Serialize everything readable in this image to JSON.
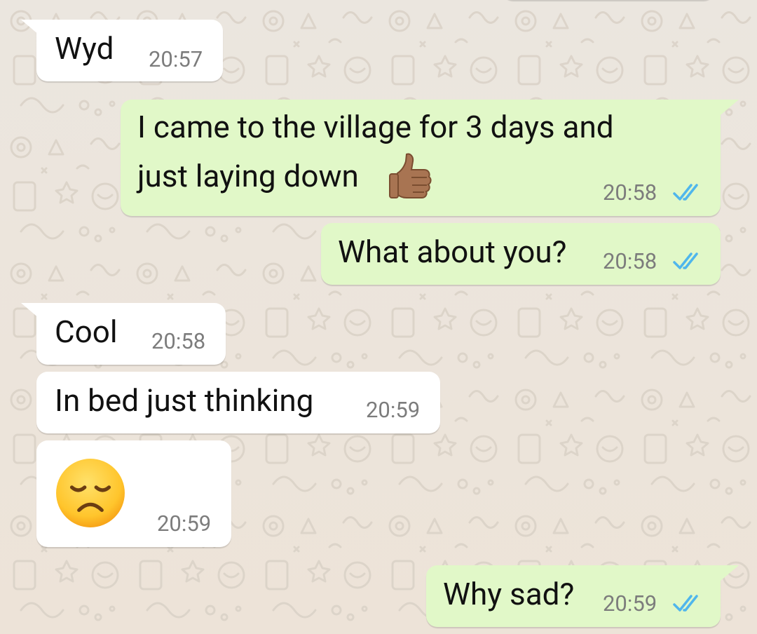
{
  "chat": {
    "messages": [
      {
        "direction": "incoming",
        "text": "Wyd",
        "time": "20:57"
      },
      {
        "direction": "outgoing",
        "text_line1": "I came to the village for 3 days and",
        "text_line2": "just laying down",
        "emoji": "thumbs-up-icon",
        "time": "20:58",
        "status": "read"
      },
      {
        "direction": "outgoing",
        "text": "What about you?",
        "time": "20:58",
        "status": "read"
      },
      {
        "direction": "incoming",
        "text": "Cool",
        "time": "20:58"
      },
      {
        "direction": "incoming",
        "text": "In bed just thinking",
        "time": "20:59"
      },
      {
        "direction": "incoming",
        "emoji": "pensive-face-icon",
        "time": "20:59"
      },
      {
        "direction": "outgoing",
        "text": "Why sad?",
        "time": "20:59",
        "status": "read"
      }
    ]
  },
  "colors": {
    "incoming_bubble": "#ffffff",
    "outgoing_bubble": "#e1f8c8",
    "wallpaper": "#ece5dd",
    "read_ticks": "#4fb6ec",
    "timestamp": "#7c7c7c"
  }
}
